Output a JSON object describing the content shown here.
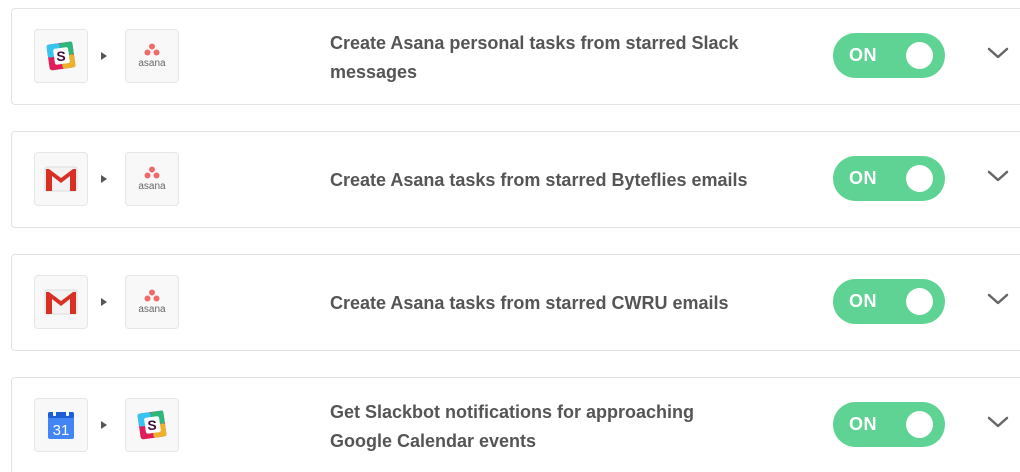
{
  "zaps": [
    {
      "trigger_app": "slack-icon",
      "action_app": "asana-icon",
      "title_line1": "Create Asana personal tasks from starred Slack",
      "title_line2": "messages",
      "toggle_label": "ON"
    },
    {
      "trigger_app": "gmail-icon",
      "action_app": "asana-icon",
      "title_line1": "Create Asana tasks from starred Byteflies emails",
      "title_line2": "",
      "toggle_label": "ON"
    },
    {
      "trigger_app": "gmail-icon",
      "action_app": "asana-icon",
      "title_line1": "Create Asana tasks from starred CWRU emails",
      "title_line2": "",
      "toggle_label": "ON"
    },
    {
      "trigger_app": "google-calendar-icon",
      "action_app": "slack-icon",
      "title_line1": "Get Slackbot notifications for approaching",
      "title_line2": "Google Calendar events",
      "toggle_label": "ON"
    }
  ],
  "asana_wordmark": "asana",
  "calendar_day": "31",
  "slack_letter": "S",
  "colors": {
    "toggle_on": "#5fd394",
    "text": "#555555",
    "asana": "#f06a6a",
    "gmail_red": "#d93025",
    "gcal_blue": "#4285f4"
  }
}
